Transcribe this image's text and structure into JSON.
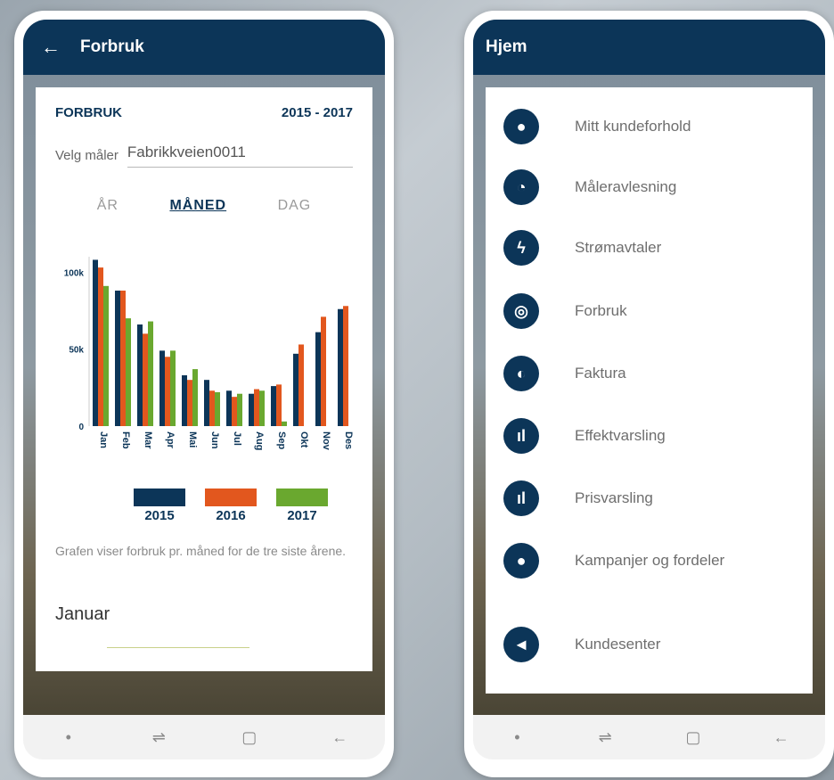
{
  "left": {
    "header_title": "Forbruk",
    "card_title": "FORBRUK",
    "year_range": "2015 - 2017",
    "meter_label": "Velg måler",
    "meter_value": "Fabrikkveien0011",
    "tabs": [
      {
        "label": "ÅR",
        "active": false
      },
      {
        "label": "MÅNED",
        "active": true
      },
      {
        "label": "DAG",
        "active": false
      }
    ],
    "legend": [
      {
        "label": "2015",
        "color": "#0c3558"
      },
      {
        "label": "2016",
        "color": "#e2571e"
      },
      {
        "label": "2017",
        "color": "#6aa82f"
      }
    ],
    "description": "Grafen viser forbruk pr. måned for de tre siste årene.",
    "selected_month": "Januar"
  },
  "right": {
    "header_title": "Hjem",
    "menu": [
      {
        "label": "Mitt kundeforhold",
        "icon": "person-icon"
      },
      {
        "label": "Måleravlesning",
        "icon": "gauge-icon"
      },
      {
        "label": "Strømavtaler",
        "icon": "lightning-icon"
      },
      {
        "label": "Forbruk",
        "icon": "compass-icon"
      },
      {
        "label": "Faktura",
        "icon": "coins-icon"
      },
      {
        "label": "Effektvarsling",
        "icon": "bar-chart-icon"
      },
      {
        "label": "Prisvarsling",
        "icon": "bar-chart-icon"
      },
      {
        "label": "Kampanjer og fordeler",
        "icon": "person-icon"
      },
      {
        "label": "Kundesenter",
        "icon": "megaphone-icon"
      }
    ]
  },
  "chart_data": {
    "type": "bar",
    "categories": [
      "Jan",
      "Feb",
      "Mar",
      "Apr",
      "Mai",
      "Jun",
      "Jul",
      "Aug",
      "Sep",
      "Okt",
      "Nov",
      "Des"
    ],
    "yticks": [
      "100k",
      "50k",
      "0"
    ],
    "ylim": [
      0,
      110000
    ],
    "series": [
      {
        "name": "2015",
        "color": "#0c3558",
        "values": [
          108000,
          88000,
          66000,
          49000,
          33000,
          30000,
          23000,
          21000,
          26000,
          47000,
          61000,
          76000
        ]
      },
      {
        "name": "2016",
        "color": "#e2571e",
        "values": [
          103000,
          88000,
          60000,
          45000,
          30000,
          23000,
          19000,
          24000,
          27000,
          53000,
          71000,
          78000
        ]
      },
      {
        "name": "2017",
        "color": "#6aa82f",
        "values": [
          91000,
          70000,
          68000,
          49000,
          37000,
          22000,
          21000,
          23000,
          3000,
          0,
          0,
          0
        ]
      }
    ]
  }
}
